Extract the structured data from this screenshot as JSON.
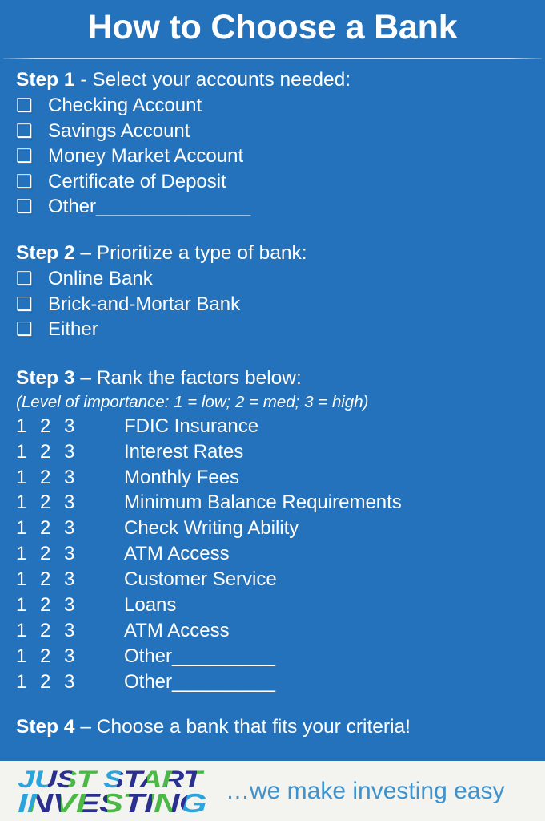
{
  "header": {
    "title": "How to Choose a Bank"
  },
  "steps": [
    {
      "id": "step-1",
      "label": "Step 1",
      "rest": " - Select your accounts needed:",
      "type": "checklist",
      "items": [
        {
          "box": "❑",
          "label": "Checking Account",
          "blank": ""
        },
        {
          "box": "❑",
          "label": "Savings Account",
          "blank": ""
        },
        {
          "box": "❑",
          "label": "Money Market Account",
          "blank": ""
        },
        {
          "box": "❑",
          "label": "Certificate of Deposit",
          "blank": ""
        },
        {
          "box": "❑",
          "label": "Other",
          "blank": "_______________"
        }
      ]
    },
    {
      "id": "step-2",
      "label": "Step 2",
      "rest": " – Prioritize a type of bank:",
      "type": "checklist",
      "items": [
        {
          "box": "❑",
          "label": "Online Bank",
          "blank": ""
        },
        {
          "box": "❑",
          "label": "Brick-and-Mortar Bank",
          "blank": ""
        },
        {
          "box": "❑",
          "label": "Either",
          "blank": ""
        }
      ]
    },
    {
      "id": "step-3",
      "label": "Step 3",
      "rest": " – Rank the factors below:",
      "type": "ranking",
      "note": "(Level of importance: 1 = low; 2 = med; 3 = high)",
      "scale": "1 2 3",
      "items": [
        {
          "nums": "1 2 3",
          "label": "FDIC Insurance",
          "blank": ""
        },
        {
          "nums": "1 2 3",
          "label": "Interest Rates",
          "blank": ""
        },
        {
          "nums": "1 2 3",
          "label": "Monthly Fees",
          "blank": ""
        },
        {
          "nums": "1 2 3",
          "label": "Minimum Balance Requirements",
          "blank": ""
        },
        {
          "nums": "1 2 3",
          "label": "Check Writing Ability",
          "blank": ""
        },
        {
          "nums": "1 2 3",
          "label": "ATM Access",
          "blank": ""
        },
        {
          "nums": "1 2 3",
          "label": "Customer Service",
          "blank": ""
        },
        {
          "nums": "1 2 3",
          "label": "Loans",
          "blank": ""
        },
        {
          "nums": "1 2 3",
          "label": "ATM Access",
          "blank": ""
        },
        {
          "nums": "1 2 3",
          "label": "Other",
          "blank": "__________"
        },
        {
          "nums": "1 2 3",
          "label": "Other",
          "blank": "__________"
        }
      ]
    },
    {
      "id": "step-4",
      "label": "Step 4",
      "rest": " – Choose a bank that fits your criteria!",
      "type": "statement",
      "items": []
    }
  ],
  "footer": {
    "logo": {
      "line1": "JUST START",
      "line2": "INVESTING",
      "name": "just-start-investing-logo"
    },
    "tagline": "…we make investing easy"
  },
  "colors": {
    "background_blue": "#2472bb",
    "text_white": "#ffffff",
    "footer_background": "#f3f3ef",
    "tagline_blue": "#3e93cf",
    "logo_light_blue": "#2ba3dd",
    "logo_navy": "#2b2f8f",
    "logo_green": "#4cb847"
  }
}
